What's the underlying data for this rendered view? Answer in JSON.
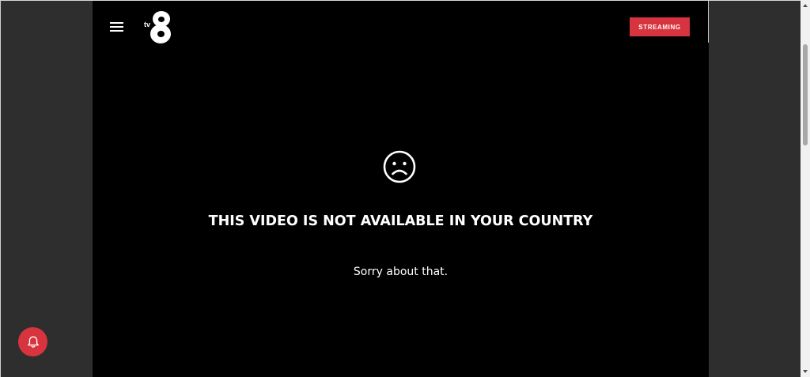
{
  "header": {
    "menu_icon": "hamburger-menu-icon",
    "logo": {
      "mark": "8",
      "sub": "tv",
      "icon": "tv8-logo"
    },
    "streaming_label": "STREAMING",
    "streaming_color": "#d8343f"
  },
  "message": {
    "icon": "sad-face-icon",
    "title": "THIS VIDEO IS NOT AVAILABLE IN YOUR COUNTRY",
    "subtitle": "Sorry about that."
  },
  "notification": {
    "icon": "bell-icon",
    "color": "#d8343f"
  },
  "colors": {
    "page_background": "#2e2e2e",
    "content_background": "#000000",
    "text": "#ffffff"
  }
}
